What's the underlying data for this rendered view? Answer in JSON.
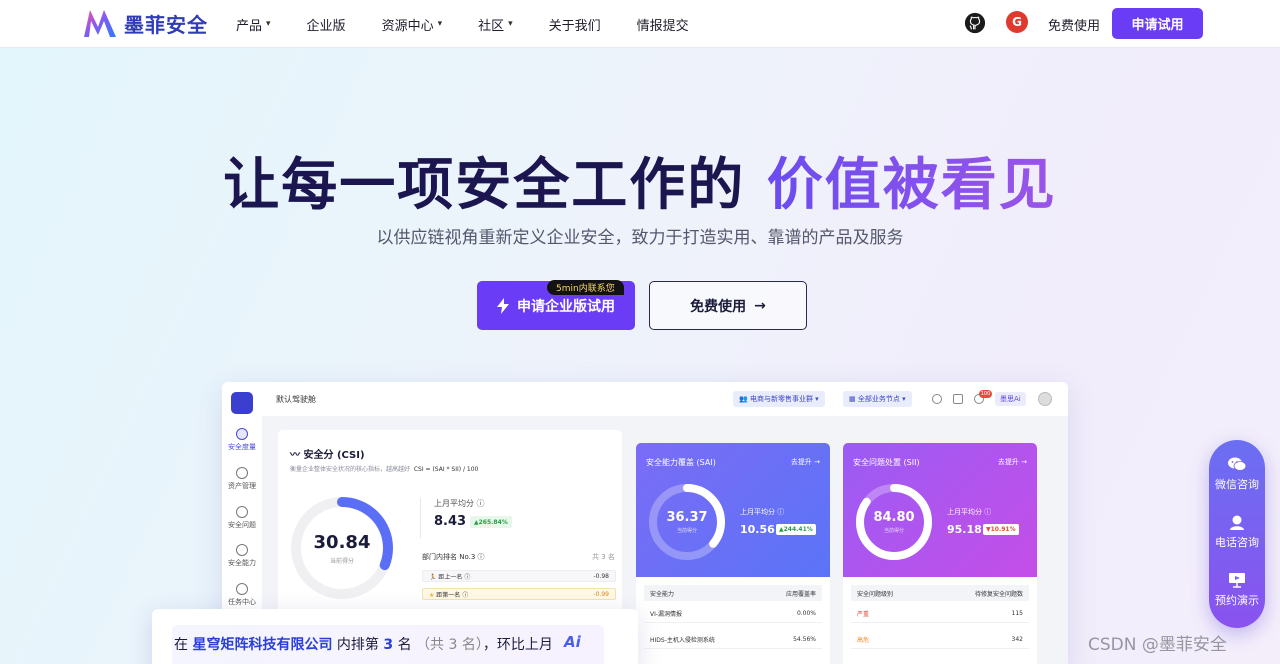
{
  "nav": {
    "brand": "墨菲安全",
    "links": [
      {
        "label": "产品",
        "dropdown": true
      },
      {
        "label": "企业版",
        "dropdown": false
      },
      {
        "label": "资源中心",
        "dropdown": true
      },
      {
        "label": "社区",
        "dropdown": true
      },
      {
        "label": "关于我们",
        "dropdown": false
      },
      {
        "label": "情报提交",
        "dropdown": false
      }
    ],
    "g_icon_letter": "G",
    "free_label": "免费使用",
    "cta_label": "申请试用"
  },
  "hero": {
    "title_main": "让每一项安全工作的",
    "title_accent": "价值被看见",
    "subtitle": "以供应链视角重新定义企业安全，致力于打造实用、靠谱的产品及服务",
    "trial_button": "申请企业版试用",
    "trial_badge": "5min内联系您",
    "free_button": "免费使用"
  },
  "dashboard": {
    "breadcrumb": "默认驾驶舱",
    "group_chip": "电商与新零售事业群",
    "node_chip": "全部业务节点",
    "bell_count": "100",
    "ai_chip": "墨思Ai",
    "sidebar": [
      {
        "label": "安全度量",
        "icon": "gauge-icon",
        "active": true
      },
      {
        "label": "资产管理",
        "icon": "cube-icon",
        "active": false
      },
      {
        "label": "安全问题",
        "icon": "shield-icon",
        "active": false
      },
      {
        "label": "安全能力",
        "icon": "shield-check-icon",
        "active": false
      },
      {
        "label": "任务中心",
        "icon": "checkbox-icon",
        "active": false
      }
    ],
    "csi": {
      "title": "安全分 (CSI)",
      "desc": "衡量企业整体安全状况的核心指标，越高越好",
      "formula": "CSI = (SAI * SII) / 100",
      "score": "30.84",
      "score_label": "当前得分",
      "score_fraction": 0.31,
      "avg_label": "上月平均分",
      "avg_value": "8.43",
      "avg_change": "265.84%",
      "rank_title": "部门内排名 No.3",
      "rank_total": "共 3 名",
      "rows": [
        {
          "label": "距上一名",
          "value": "-0.98",
          "highlight": false
        },
        {
          "label": "距第一名",
          "value": "-0.99",
          "highlight": true
        }
      ]
    },
    "sai": {
      "title": "安全能力覆盖 (SAI)",
      "link": "去提升 →",
      "score": "36.37",
      "score_label": "当前得分",
      "score_fraction": 0.36,
      "avg_label": "上月平均分",
      "avg_value": "10.56",
      "avg_change": "244.41%",
      "col1": "安全能力",
      "col2": "应用覆盖率",
      "rows": [
        {
          "label": "VI-漏洞情报",
          "value": "0.00%"
        },
        {
          "label": "HIDS-主机入侵检测系统",
          "value": "54.56%"
        }
      ]
    },
    "sii": {
      "title": "安全问题处置 (SII)",
      "link": "去提升 →",
      "score": "84.80",
      "score_label": "当前得分",
      "score_fraction": 0.85,
      "avg_label": "上月平均分",
      "avg_value": "95.18",
      "avg_change": "10.91%",
      "col1": "安全问题级别",
      "col2": "待修复安全问题数",
      "rows": [
        {
          "label": "严重",
          "value": "115"
        },
        {
          "label": "高危",
          "value": "342"
        }
      ]
    }
  },
  "rank_card": {
    "prefix": "在",
    "company": "星穹矩阵科技有限公司",
    "mid": "内排第",
    "rank": "3",
    "unit": "名",
    "total": "（共 3 名）",
    "suffix": "，环比上月",
    "ai_label": "Ai"
  },
  "contact": {
    "items": [
      {
        "label": "微信咨询",
        "icon": "wechat-icon"
      },
      {
        "label": "电话咨询",
        "icon": "headset-icon"
      },
      {
        "label": "预约演示",
        "icon": "presentation-icon"
      }
    ]
  },
  "watermark": "CSDN @墨菲安全",
  "colors": {
    "primary": "#6a3cf5",
    "brand_blue": "#2f3bb8",
    "sai_gradient": [
      "#7b6cf6",
      "#5a74f7"
    ],
    "sii_gradient": [
      "#9a5cf4",
      "#c54ee8"
    ]
  }
}
